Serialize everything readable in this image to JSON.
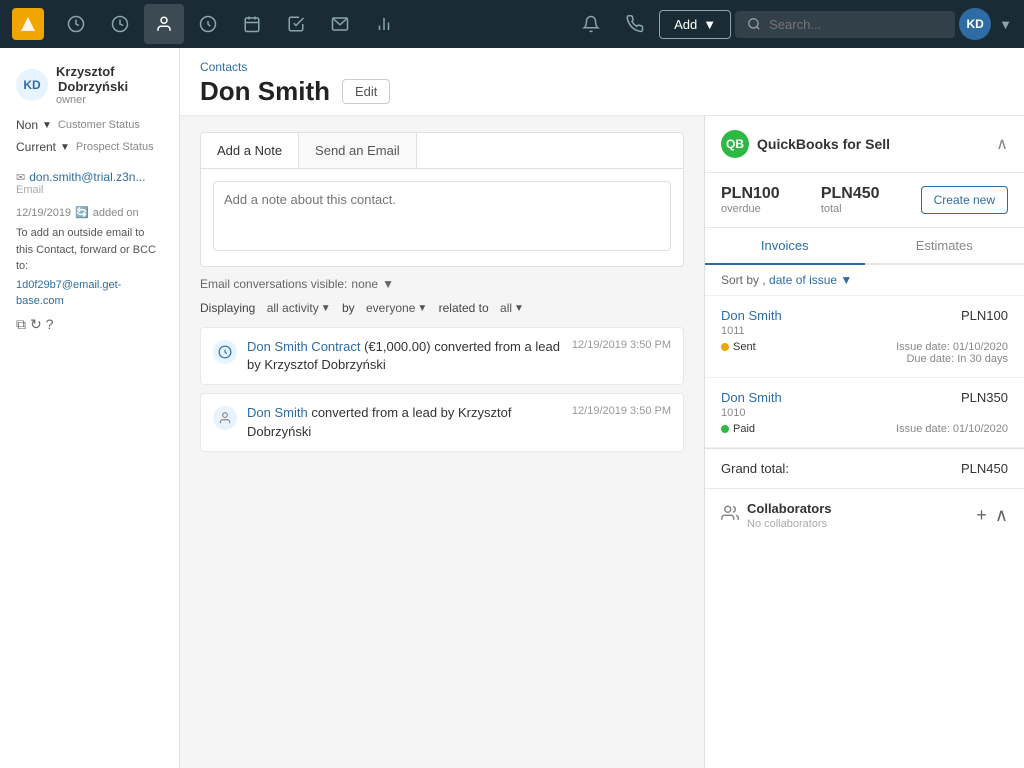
{
  "app": {
    "logo_initials": "▲",
    "nav_icons": [
      "dashboard",
      "timer",
      "person",
      "dollar",
      "calendar",
      "check",
      "email",
      "chart"
    ],
    "add_button": "Add",
    "search_placeholder": "Search...",
    "user_initials": "KD"
  },
  "breadcrumb": "Contacts",
  "contact": {
    "name": "Don Smith",
    "edit_label": "Edit",
    "owner": {
      "initials": "KD",
      "first_name": "Krzysztof",
      "last_name": "Dobrzyński",
      "role": "owner"
    },
    "customer_status": {
      "label": "Customer Status",
      "value": "Non"
    },
    "prospect_status": {
      "label": "Prospect Status",
      "value": "Current"
    },
    "email": {
      "value": "don.smith@trial.z3n...",
      "label": "Email"
    },
    "added_on": "12/19/2019",
    "added_label": "added on",
    "forward_email_text": "To add an outside email to this Contact, forward or BCC to:",
    "forward_email_address": "1d0f29b7@email.get-base.com"
  },
  "notes": {
    "add_note_tab": "Add a Note",
    "send_email_tab": "Send an Email",
    "placeholder": "Add a note about this contact."
  },
  "email_visibility": {
    "label": "Email conversations visible:",
    "value": "none"
  },
  "activity": {
    "displaying_label": "Displaying",
    "all_activity": "all activity",
    "by": "by",
    "everyone": "everyone",
    "related_to": "related to",
    "all": "all",
    "items": [
      {
        "type": "deal",
        "text_before": "Don Smith Contract",
        "amount": "(€1,000.00)",
        "text_after": "converted from a lead by Krzysztof Dobrzyński",
        "timestamp": "12/19/2019 3:50 PM",
        "link": "Don Smith Contract"
      },
      {
        "type": "person",
        "text_before": "",
        "link": "Don Smith",
        "text_after": "converted from a lead by Krzysztof Dobrzyński",
        "timestamp": "12/19/2019 3:50 PM"
      }
    ]
  },
  "quickbooks": {
    "title": "QuickBooks for Sell",
    "logo_text": "QB",
    "overdue_amount": "PLN100",
    "overdue_label": "overdue",
    "total_amount": "PLN450",
    "total_label": "total",
    "create_new_label": "Create new",
    "tabs": [
      "Invoices",
      "Estimates"
    ],
    "active_tab": "Invoices",
    "sort_label": "Sort by ,",
    "sort_value": "date of issue",
    "invoices": [
      {
        "name": "Don Smith",
        "number": "1011",
        "amount": "PLN100",
        "status": "Sent",
        "status_type": "sent",
        "issue_date": "Issue date: 01/10/2020",
        "due_date": "Due date: In 30 days"
      },
      {
        "name": "Don Smith",
        "number": "1010",
        "amount": "PLN350",
        "status": "Paid",
        "status_type": "paid",
        "issue_date": "Issue date: 01/10/2020",
        "due_date": ""
      }
    ],
    "grand_total_label": "Grand total:",
    "grand_total_value": "PLN450"
  },
  "collaborators": {
    "title": "Collaborators",
    "subtitle": "No collaborators"
  }
}
